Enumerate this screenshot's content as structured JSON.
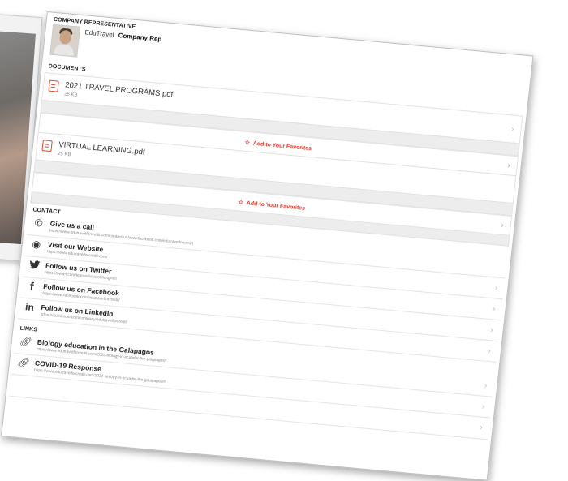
{
  "rep": {
    "section_title": "COMPANY REPRESENTATIVE",
    "company": "EduTravel",
    "role": "Company Rep"
  },
  "documents": {
    "section_title": "DOCUMENTS",
    "items": [
      {
        "name": "2021 TRAVEL PROGRAMS.pdf",
        "size": "25 KB",
        "favorite_label": "Add to Your Favorites"
      },
      {
        "name": "VIRTUAL LEARNING.pdf",
        "size": "25 KB",
        "favorite_label": "Add to Your Favorites"
      }
    ]
  },
  "contact": {
    "section_title": "CONTACT",
    "items": [
      {
        "icon": "phone-icon",
        "title": "Give us a call",
        "url": "https://www.edutravelforcredit.com/contact-us/www.facebook.com/edutravelforcredit"
      },
      {
        "icon": "globe-icon",
        "title": "Visit our Website",
        "url": "https://www.edutravelforcredit.com/"
      },
      {
        "icon": "twitter-icon",
        "title": "Follow us on Twitter",
        "url": "https://twitter.com/teamedutravel?lang=en"
      },
      {
        "icon": "facebook-icon",
        "title": "Follow us on Facebook",
        "url": "https://www.facebook.com/edutravelforcredit/"
      },
      {
        "icon": "linkedin-icon",
        "title": "Follow us on LinkedIn",
        "url": "https://ca.linkedin.com/company/edutravelforcredit"
      }
    ]
  },
  "links": {
    "section_title": "LINKS",
    "items": [
      {
        "icon": "link-icon",
        "title": "Biology education in the Galapagos",
        "url": "https://www.edutravelforcredit.com/2022-biology-in-ecuador-the-galapagos/"
      },
      {
        "icon": "link-icon",
        "title": "COVID-19 Response",
        "url": "https://www.edutravelforcredit.com/2022-biology-in-ecuador-the-galapagos/#"
      }
    ]
  },
  "colors": {
    "accent": "#e8392a",
    "pdf": "#e2472f",
    "border": "#e1e1e1"
  }
}
